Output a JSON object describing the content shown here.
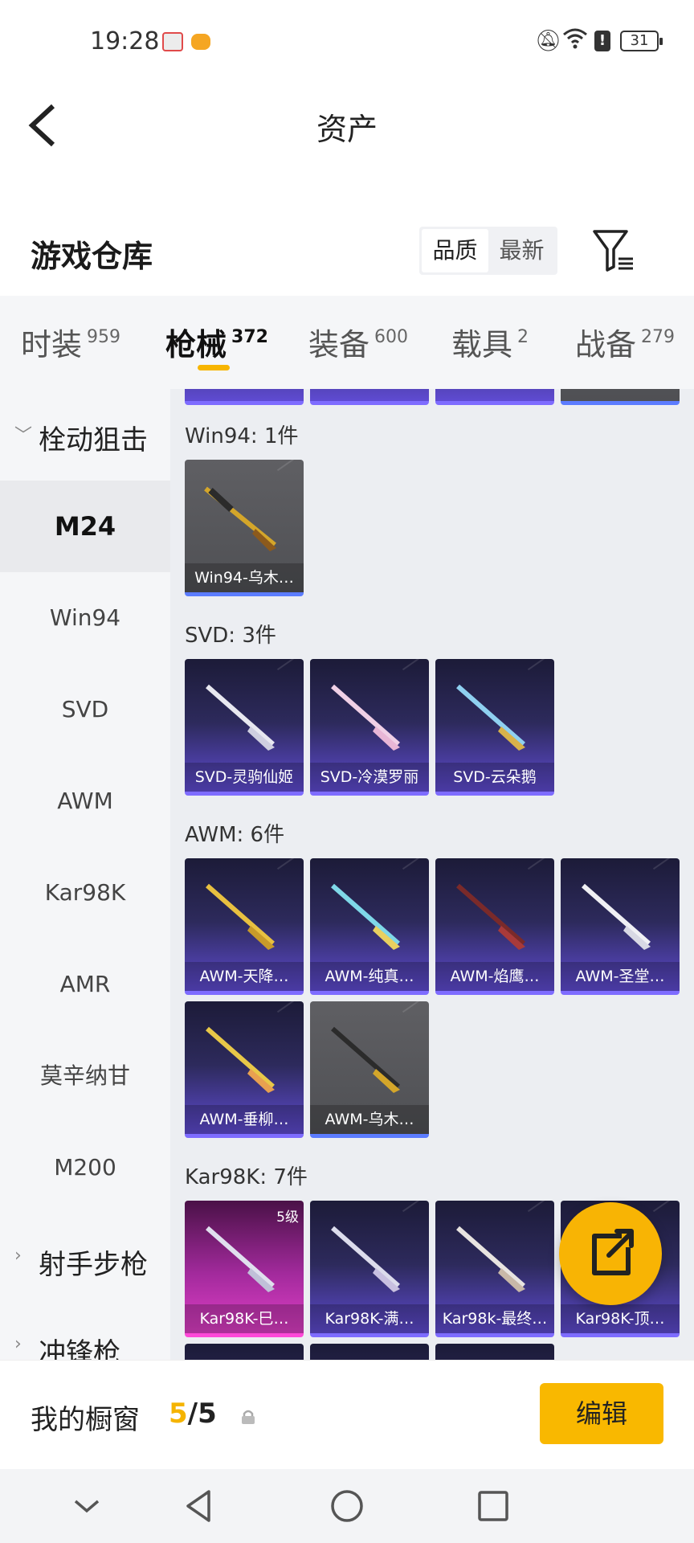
{
  "status_bar": {
    "time": "19:28",
    "battery": "31"
  },
  "header": {
    "title": "资产"
  },
  "warehouse": {
    "title": "游戏仓库",
    "sort_options": [
      "品质",
      "最新"
    ]
  },
  "categories": [
    {
      "label": "时装",
      "count": "959"
    },
    {
      "label": "枪械",
      "count": "372"
    },
    {
      "label": "装备",
      "count": "600"
    },
    {
      "label": "载具",
      "count": "2"
    },
    {
      "label": "战备",
      "count": "279"
    }
  ],
  "sidebar": {
    "groups": [
      "栓动狙击",
      "射手步枪",
      "冲锋枪"
    ],
    "items": [
      "M24",
      "Win94",
      "SVD",
      "AWM",
      "Kar98K",
      "AMR",
      "莫辛纳甘",
      "M200"
    ]
  },
  "sections": [
    {
      "title": "Win94: 1件",
      "items": [
        {
          "name": "Win94-乌木…",
          "style": "grey"
        }
      ]
    },
    {
      "title": "SVD: 3件",
      "items": [
        {
          "name": "SVD-灵驹仙姬",
          "style": "purple"
        },
        {
          "name": "SVD-冷漠罗丽",
          "style": "purple"
        },
        {
          "name": "SVD-云朵鹅",
          "style": "purple"
        }
      ]
    },
    {
      "title": "AWM: 6件",
      "items": [
        {
          "name": "AWM-天降…",
          "style": "purple"
        },
        {
          "name": "AWM-纯真…",
          "style": "purple"
        },
        {
          "name": "AWM-焰鹰…",
          "style": "purple"
        },
        {
          "name": "AWM-圣堂…",
          "style": "purple"
        },
        {
          "name": "AWM-垂柳…",
          "style": "purple"
        },
        {
          "name": "AWM-乌木…",
          "style": "grey"
        }
      ]
    },
    {
      "title": "Kar98K: 7件",
      "items": [
        {
          "name": "Kar98K-巳…",
          "style": "pink",
          "level": "5级"
        },
        {
          "name": "Kar98K-满…",
          "style": "purple"
        },
        {
          "name": "Kar98k-最终…",
          "style": "purple"
        },
        {
          "name": "Kar98K-顶…",
          "style": "purple"
        }
      ]
    }
  ],
  "showcase": {
    "label": "我的橱窗",
    "current": "5",
    "total": "/5",
    "edit_label": "编辑"
  },
  "colors": {
    "accent": "#f8b404",
    "rare": "#7e6cff",
    "legend": "#ff49d8"
  }
}
